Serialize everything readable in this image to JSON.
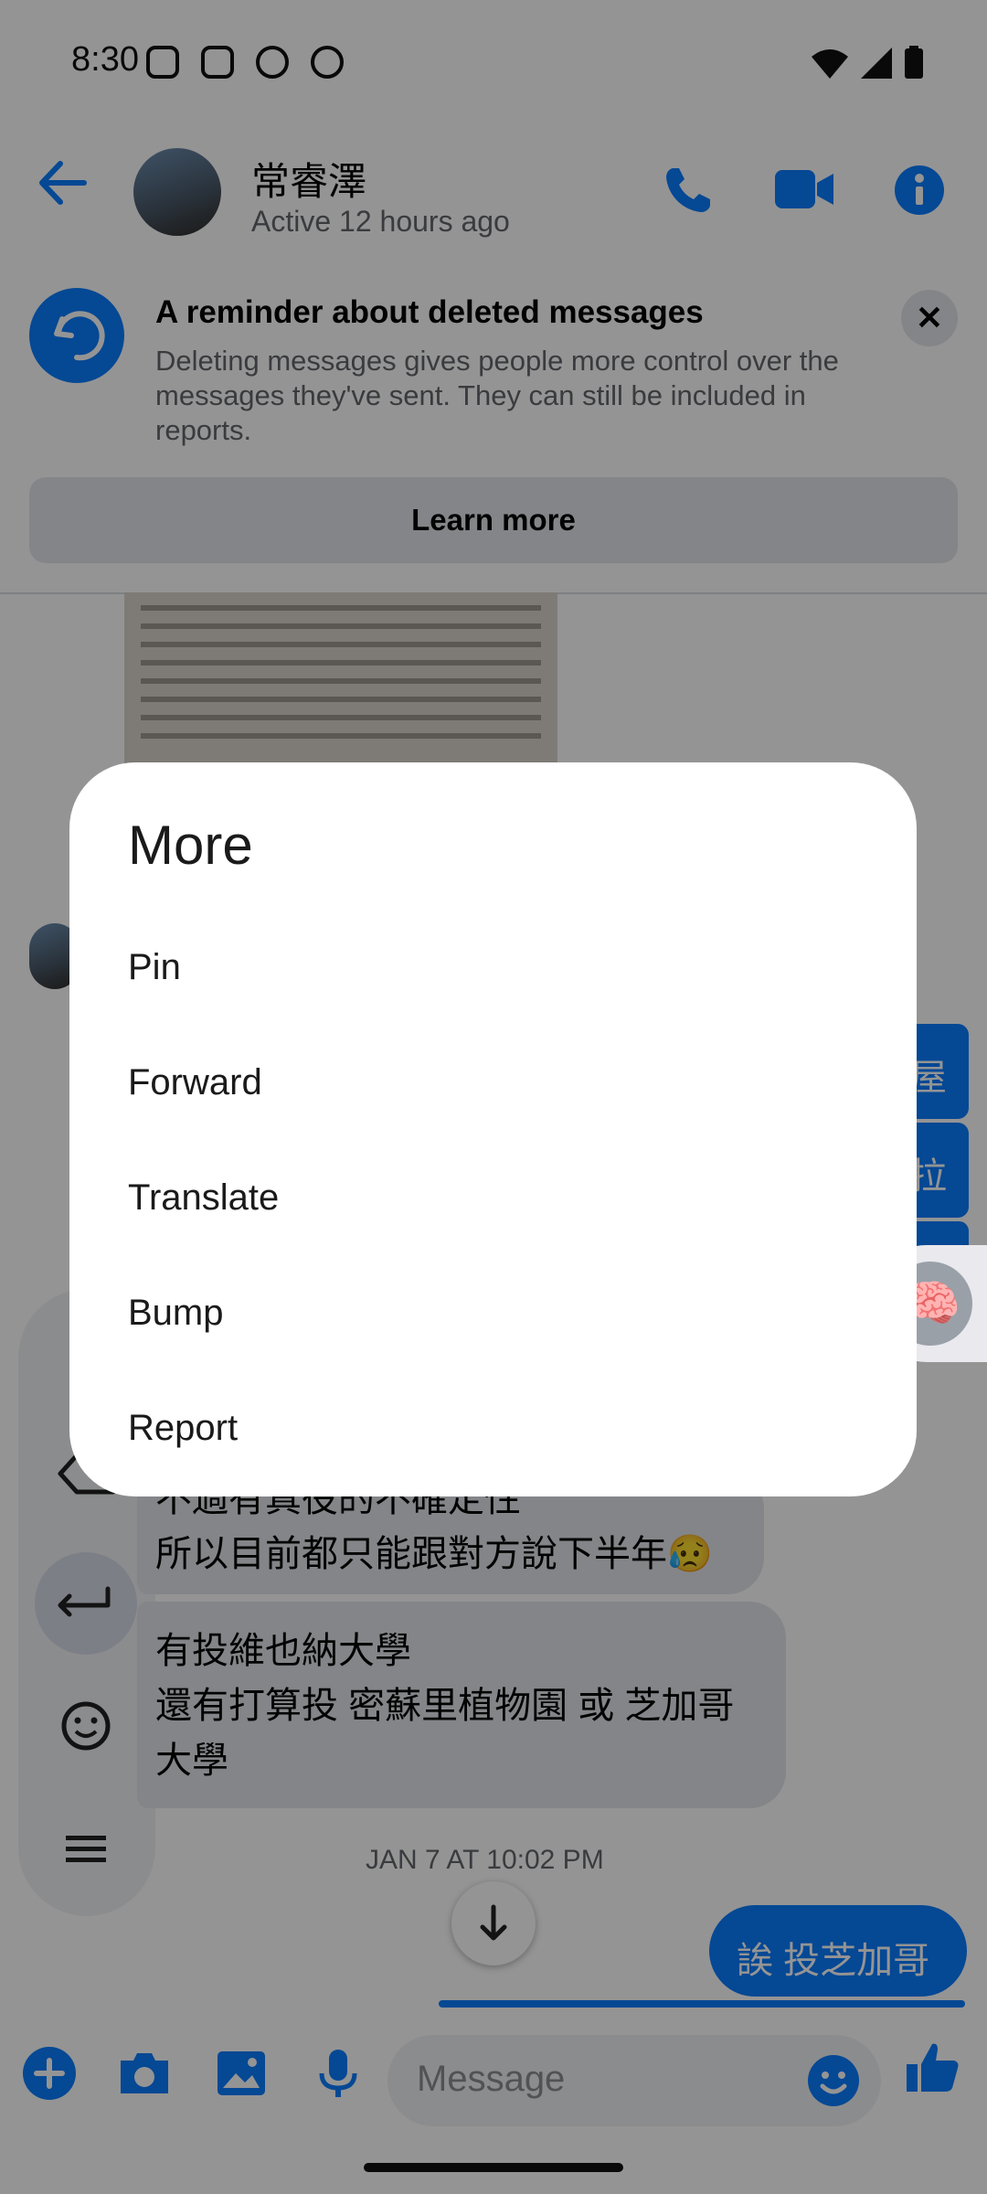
{
  "status_bar": {
    "time": "8:30"
  },
  "header": {
    "name": "常睿澤",
    "active": "Active 12 hours ago"
  },
  "reminder": {
    "title": "A reminder about deleted messages",
    "body": "Deleting messages gives people more control over the messages they've sent. They can still be included in reports.",
    "learn_more": "Learn more"
  },
  "messages": {
    "right_partial_1": "屋",
    "right_partial_2": "拉",
    "left_1_line_1": "不過有真役的不確定性",
    "left_1_line_2": "所以目前都只能跟對方說下半年😥",
    "left_2_line_1": "有投維也納大學",
    "left_2_line_2": "還有打算投 密蘇里植物園 或 芝加哥",
    "left_2_line_3": "大學",
    "timestamp": "JAN 7 AT 10:02 PM",
    "right_3": "誒 投芝加哥"
  },
  "composer": {
    "placeholder": "Message"
  },
  "dialog": {
    "title": "More",
    "items": [
      "Pin",
      "Forward",
      "Translate",
      "Bump",
      "Report"
    ]
  },
  "colors": {
    "accent": "#0a7cff",
    "scrim": "rgba(0,0,0,0.42)"
  },
  "icons": {
    "back": "arrow-left",
    "call": "phone",
    "video": "video-camera",
    "info": "info-circle",
    "close": "close",
    "scroll_down": "arrow-down",
    "add": "plus-circle",
    "camera": "camera",
    "gallery": "image",
    "mic": "microphone",
    "emoji": "smiley",
    "like": "thumbs-up"
  }
}
